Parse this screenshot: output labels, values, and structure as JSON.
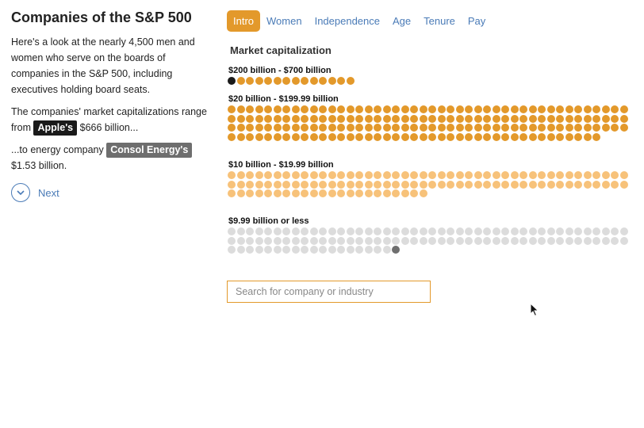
{
  "sidebar": {
    "title": "Companies of the S&P 500",
    "intro": "Here's a look at the nearly 4,500 men and women who serve on the boards of companies in the S&P 500, including executives holding board seats.",
    "range_prefix": "The companies' market capitalizations range from",
    "range_top_company": "Apple's",
    "range_top_value": "$666 billion...",
    "range_low_prefix": "...to energy company",
    "range_low_company": "Consol Energy's",
    "range_low_value": "$1.53 billion.",
    "next_label": "Next"
  },
  "tabs": [
    {
      "label": "Intro",
      "active": true
    },
    {
      "label": "Women",
      "active": false
    },
    {
      "label": "Independence",
      "active": false
    },
    {
      "label": "Age",
      "active": false
    },
    {
      "label": "Tenure",
      "active": false
    },
    {
      "label": "Pay",
      "active": false
    }
  ],
  "chart": {
    "title": "Market capitalization",
    "groups": [
      {
        "label": "$200 billion - $700 billion",
        "count": 14,
        "color": "#e3992b",
        "highlight_first": true,
        "highlight_color": "#1a1a1a"
      },
      {
        "label": "$20 billion - $199.99 billion",
        "count": 173,
        "color": "#e3992b",
        "highlight_first": false
      },
      {
        "label": "$10 billion - $19.99 billion",
        "count": 110,
        "color": "#f7c27a",
        "highlight_first": false
      },
      {
        "label": "$9.99 billion or less",
        "count": 107,
        "color": "#dcdcdc",
        "highlight_last": true,
        "highlight_color": "#6e6e6e"
      }
    ]
  },
  "search": {
    "placeholder": "Search for company or industry",
    "value": ""
  },
  "colors": {
    "accent": "#e3992b",
    "link": "#4a7bb7"
  }
}
